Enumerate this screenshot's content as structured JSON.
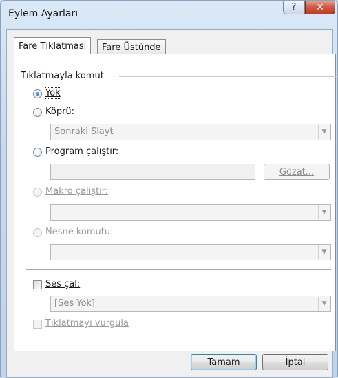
{
  "window": {
    "title": "Eylem Ayarları"
  },
  "title_buttons": {
    "help": "?",
    "close": "✕"
  },
  "tabs": [
    {
      "label": "Fare Tıklatması",
      "active": true
    },
    {
      "label": "Fare Üstünde",
      "active": false
    }
  ],
  "group": {
    "label": "Tıklatmayla komut"
  },
  "options": {
    "none": {
      "label": "Yok",
      "checked": true,
      "enabled": true
    },
    "hyperlink": {
      "label": "Köprü:",
      "checked": false,
      "enabled": true,
      "value": "Sonraki Slayt"
    },
    "run_program": {
      "label": "Program çalıştır:",
      "checked": false,
      "enabled": true,
      "value": "",
      "browse_label": "Gözat..."
    },
    "run_macro": {
      "label": "Makro çalıştır:",
      "checked": false,
      "enabled": false,
      "value": ""
    },
    "object_action": {
      "label": "Nesne komutu:",
      "checked": false,
      "enabled": false,
      "value": ""
    }
  },
  "sound": {
    "label": "Ses çal:",
    "checked": false,
    "value": "[Ses Yok]"
  },
  "highlight": {
    "label": "Tıklatmayı vurgula",
    "checked": false,
    "enabled": false
  },
  "buttons": {
    "ok": "Tamam",
    "cancel": "İptal"
  }
}
